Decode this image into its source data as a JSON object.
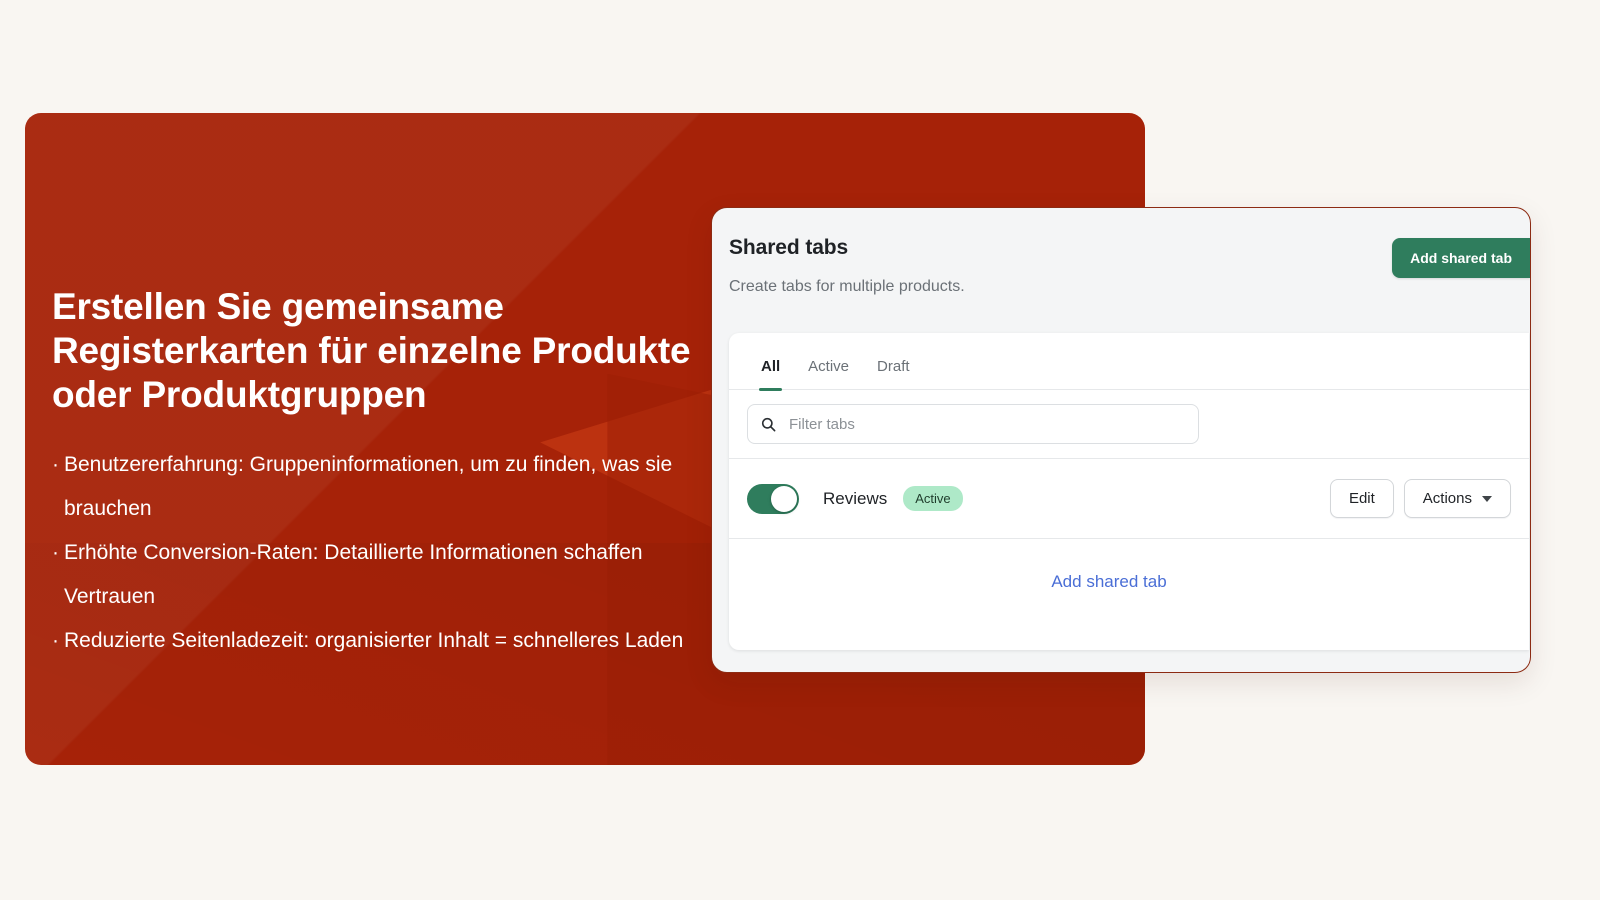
{
  "background_color": "#f9f6f2",
  "promo": {
    "panel_color": "#a62208",
    "heading": "Erstellen Sie gemeinsame Registerkarten für einzelne Produkte oder Produktgruppen",
    "bullet_marker": "·",
    "bullets": [
      "Benutzererfahrung: Gruppeninformationen, um zu finden, was sie brauchen",
      "Erhöhte Conversion-Raten: Detaillierte Informationen schaffen Vertrauen",
      "Reduzierte Seitenladezeit: organisierter Inhalt = schnelleres Laden"
    ]
  },
  "app_card": {
    "accent_color": "#2f7d5d",
    "border_color": "#8c2b13",
    "header": {
      "title": "Shared tabs",
      "subtitle": "Create tabs for multiple products.",
      "primary_button": "Add shared tab"
    },
    "tabs": [
      {
        "label": "All",
        "active": true
      },
      {
        "label": "Active",
        "active": false
      },
      {
        "label": "Draft",
        "active": false
      }
    ],
    "filter": {
      "placeholder": "Filter tabs",
      "value": "",
      "icon": "search-icon"
    },
    "rows": [
      {
        "name": "Reviews",
        "enabled": true,
        "status_badge": "Active",
        "status_badge_bg": "#aee9c8",
        "edit_label": "Edit",
        "actions_label": "Actions",
        "actions_icon": "chevron-down-icon"
      }
    ],
    "footer": {
      "link_label": "Add shared tab",
      "link_color": "#4a6ed6"
    }
  }
}
